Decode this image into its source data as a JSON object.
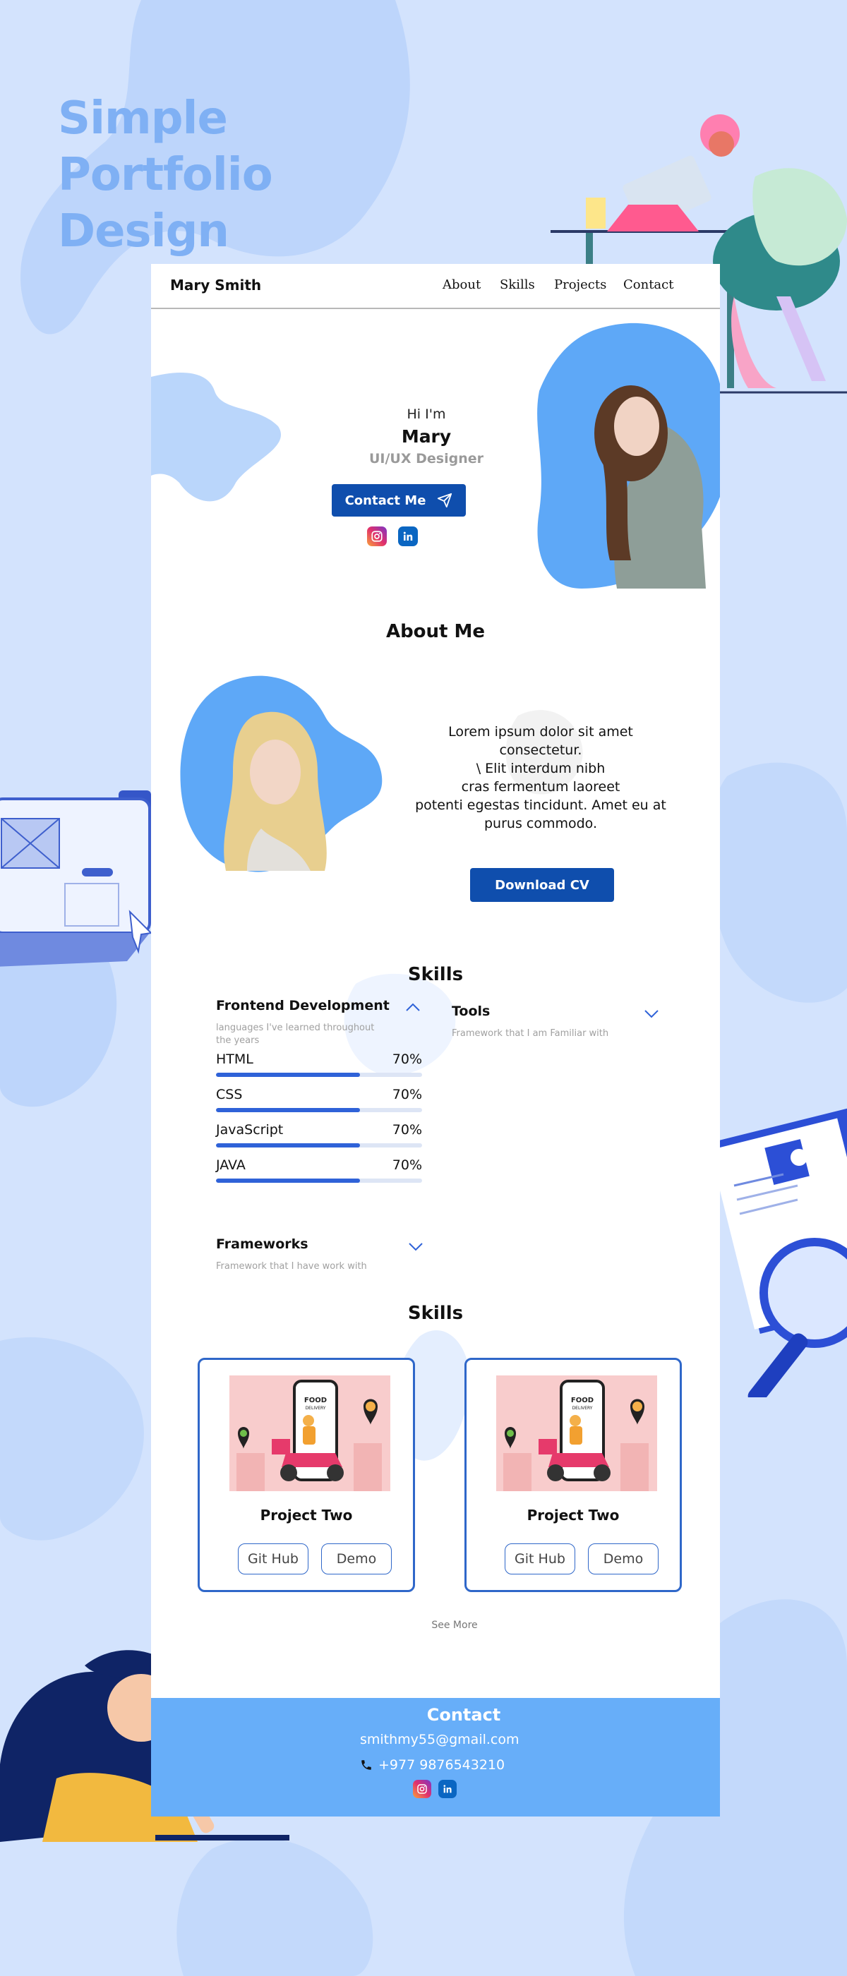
{
  "showcase": {
    "title": "Simple Portfolio Design"
  },
  "nav": {
    "brand": "Mary Smith",
    "links": [
      "About",
      "Skills",
      "Projects",
      "Contact"
    ]
  },
  "hero": {
    "greeting": "Hi I'm",
    "name": "Mary",
    "role": "UI/UX Designer",
    "contact_button": "Contact Me",
    "social_icons": [
      "instagram-icon",
      "linkedin-icon"
    ]
  },
  "about": {
    "title": "About Me",
    "lines": [
      "Lorem ipsum dolor sit amet",
      "consectetur.",
      "\\ Elit interdum nibh",
      "cras fermentum laoreet",
      "potenti egestas tincidunt. Amet eu at",
      "purus commodo."
    ],
    "cv_button": "Download CV"
  },
  "skills": {
    "title": "Skills",
    "frontend": {
      "title": "Frontend Development",
      "subtitle_lines": [
        "languages I've learned throughout",
        "the years"
      ],
      "items": [
        {
          "name": "HTML",
          "percent_label": "70%",
          "percent": 70
        },
        {
          "name": "CSS",
          "percent_label": "70%",
          "percent": 70
        },
        {
          "name": "JavaScript",
          "percent_label": "70%",
          "percent": 70
        },
        {
          "name": "JAVA",
          "percent_label": "70%",
          "percent": 70
        }
      ]
    },
    "tools": {
      "title": "Tools",
      "subtitle": "Framework that I am Familiar with"
    },
    "frameworks": {
      "title": "Frameworks",
      "subtitle": "Framework that I have work with"
    }
  },
  "projects": {
    "title": "Skills",
    "cards": [
      {
        "image_caption": "FOOD",
        "image_caption_2": "DELIVERY",
        "title": "Project Two",
        "github": "Git Hub",
        "demo": "Demo"
      },
      {
        "image_caption": "FOOD",
        "image_caption_2": "DELIVERY",
        "title": "Project Two",
        "github": "Git Hub",
        "demo": "Demo"
      }
    ],
    "see_more": "See More"
  },
  "contact": {
    "title": "Contact",
    "email": "smithmy55@gmail.com",
    "phone": "+977 9876543210"
  },
  "colors": {
    "page_bg": "#d3e3fd",
    "accent": "#0f4ead",
    "blob": "#5ea8f7",
    "contact_bg": "#67aef9"
  }
}
